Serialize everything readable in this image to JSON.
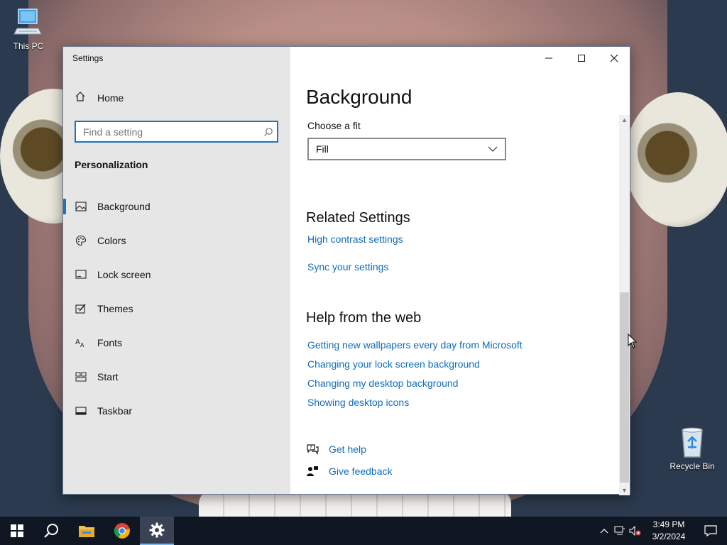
{
  "desktop": {
    "icons": [
      {
        "label": "This PC"
      },
      {
        "label": "Recycle Bin"
      }
    ]
  },
  "window": {
    "title": "Settings",
    "controls": {
      "minimize": "minimize",
      "maximize": "maximize",
      "close": "close"
    }
  },
  "sidebar": {
    "home_label": "Home",
    "search_placeholder": "Find a setting",
    "section_title": "Personalization",
    "items": [
      {
        "label": "Background",
        "icon": "picture-icon",
        "selected": true
      },
      {
        "label": "Colors",
        "icon": "palette-icon",
        "selected": false
      },
      {
        "label": "Lock screen",
        "icon": "lock-screen-icon",
        "selected": false
      },
      {
        "label": "Themes",
        "icon": "themes-icon",
        "selected": false
      },
      {
        "label": "Fonts",
        "icon": "fonts-icon",
        "selected": false
      },
      {
        "label": "Start",
        "icon": "start-icon",
        "selected": false
      },
      {
        "label": "Taskbar",
        "icon": "taskbar-icon",
        "selected": false
      }
    ]
  },
  "content": {
    "title": "Background",
    "fit_label": "Choose a fit",
    "fit_value": "Fill",
    "related_title": "Related Settings",
    "related_links": [
      "High contrast settings",
      "Sync your settings"
    ],
    "help_title": "Help from the web",
    "help_links": [
      "Getting new wallpapers every day from Microsoft",
      "Changing your lock screen background",
      "Changing my desktop background",
      "Showing desktop icons"
    ],
    "get_help": "Get help",
    "give_feedback": "Give feedback"
  },
  "taskbar": {
    "apps": [
      "start",
      "search",
      "file-explorer",
      "chrome",
      "settings"
    ],
    "time": "3:49 PM",
    "date": "3/2/2024"
  },
  "colors": {
    "accent": "#1f74bd",
    "link": "#0f6cbd",
    "sidebar_bg": "#e6e6e6",
    "taskbar_bg": "#101722"
  }
}
